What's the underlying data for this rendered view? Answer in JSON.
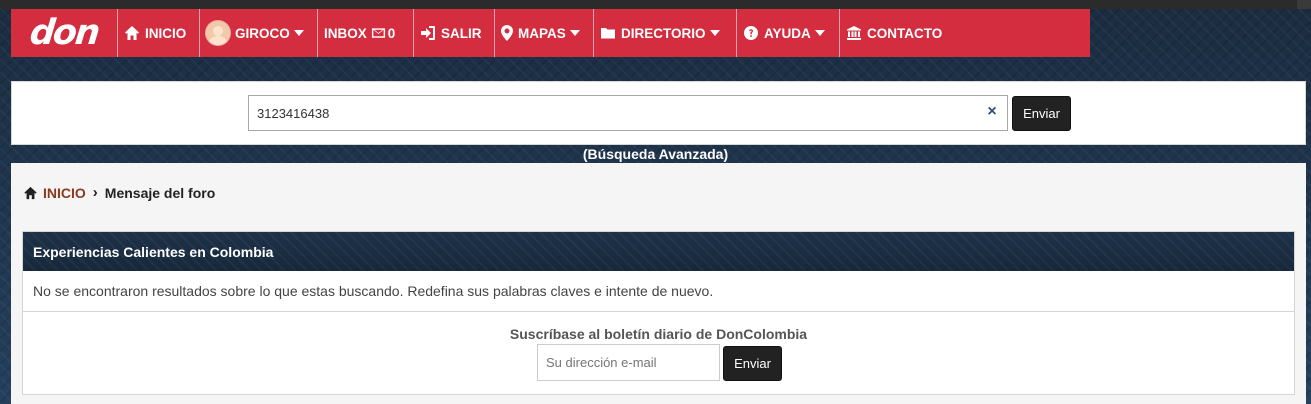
{
  "brand": {
    "logo_text": "don"
  },
  "nav": {
    "items": [
      {
        "label": "INICIO",
        "icon": "home-icon"
      },
      {
        "label": "GIROCO",
        "icon": "avatar",
        "dropdown": true
      },
      {
        "label": "INBOX",
        "icon": "envelope-icon",
        "count": "0"
      },
      {
        "label": "SALIR",
        "icon": "sign-in-icon"
      },
      {
        "label": "MAPAS",
        "icon": "map-marker-icon",
        "dropdown": true
      },
      {
        "label": "DIRECTORIO",
        "icon": "folder-icon",
        "dropdown": true
      },
      {
        "label": "AYUDA",
        "icon": "question-circle-icon",
        "dropdown": true
      },
      {
        "label": "CONTACTO",
        "icon": "institution-icon"
      }
    ]
  },
  "search": {
    "value": "3123416438",
    "clear_label": "×",
    "button_label": "Enviar",
    "advanced_label": "(Búsqueda Avanzada)"
  },
  "breadcrumb": {
    "home_label": "INICIO",
    "separator": "›",
    "current": "Mensaje del foro"
  },
  "panel": {
    "title": "Experiencias Calientes en Colombia",
    "message": "No se encontraron resultados sobre lo que estas buscando. Redefina sus palabras claves e intente de nuevo."
  },
  "newsletter": {
    "title": "Suscríbase al boletín diario de DonColombia",
    "placeholder": "Su dirección e-mail",
    "button_label": "Enviar"
  },
  "colors": {
    "navbar_red": "#d42d3f",
    "panel_heading": "#1c2d40",
    "link_brown": "#8b3a1f",
    "button_dark": "#222222"
  }
}
